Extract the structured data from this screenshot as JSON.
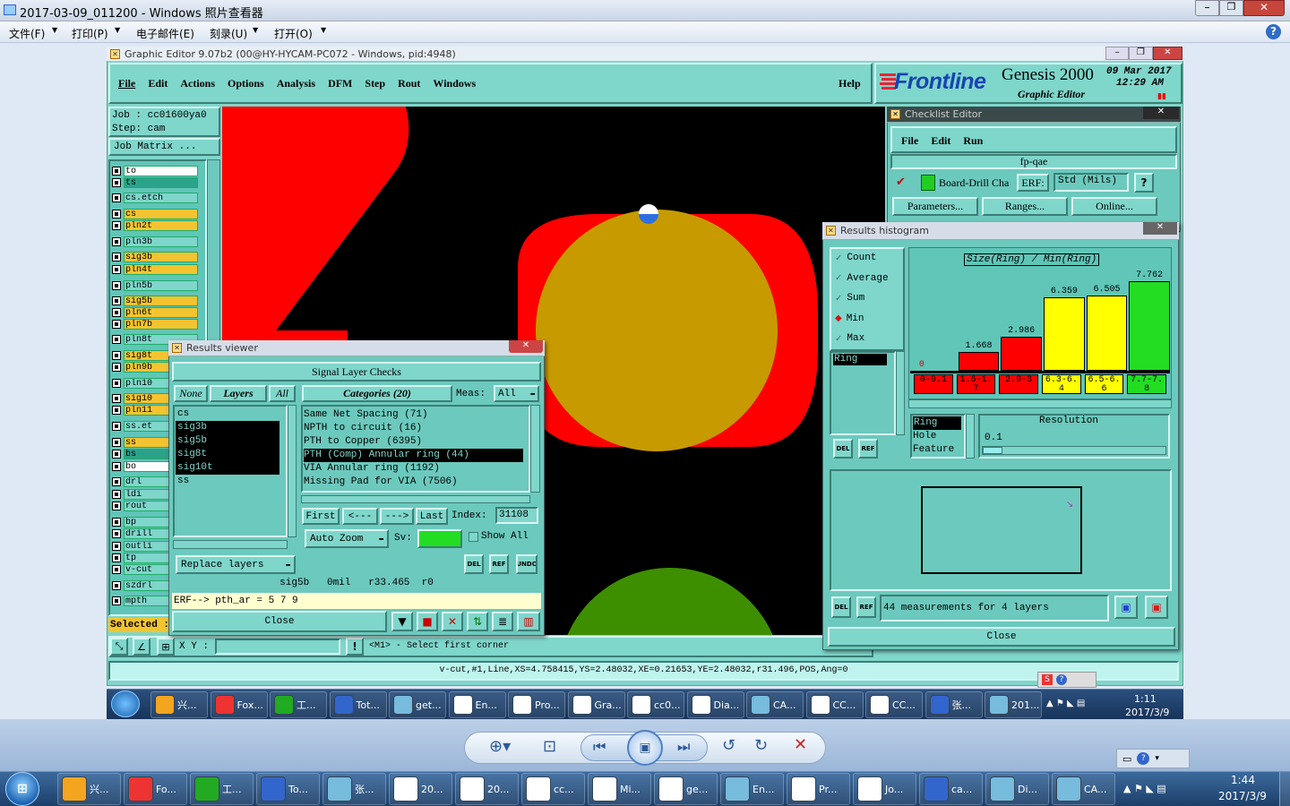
{
  "viewer": {
    "title": "2017-03-09_011200 - Windows 照片查看器",
    "menu": [
      "文件(F)",
      "打印(P)",
      "电子邮件(E)",
      "刻录(U)",
      "打开(O)"
    ]
  },
  "genesis": {
    "title": "Graphic Editor 9.07b2 (00@HY-HYCAM-PC072 - Windows, pid:4948)",
    "menu": [
      "File",
      "Edit",
      "Actions",
      "Options",
      "Analysis",
      "DFM",
      "Step",
      "Rout",
      "Windows"
    ],
    "help": "Help",
    "brand": "Frontline",
    "product": "Genesis 2000",
    "product_sub": "Graphic Editor",
    "date": "09 Mar 2017",
    "time": "12:29 AM",
    "job": "Job : cc01600ya0",
    "step": "Step: cam",
    "job_matrix": "Job Matrix ...",
    "selected": "Selected :",
    "xy_label": "X Y :",
    "prompt": "<M1> - Select first corner",
    "status": "v-cut,#1,Line,XS=4.758415,YS=2.48032,XE=0.21653,YE=2.48032,r31.496,POS,Ang=0"
  },
  "layers": [
    {
      "name": "to",
      "color": "#ffffff"
    },
    {
      "name": "ts",
      "color": "#2aa38a"
    },
    {
      "name": "cs.etch",
      "color": "#7fd6cb"
    },
    {
      "name": "cs",
      "color": "#f4c430"
    },
    {
      "name": "pln2t",
      "color": "#f4c430"
    },
    {
      "name": "pln3b",
      "color": "#7fd6cb"
    },
    {
      "name": "sig3b",
      "color": "#f4c430"
    },
    {
      "name": "pln4t",
      "color": "#f4c430"
    },
    {
      "name": "pln5b",
      "color": "#7fd6cb"
    },
    {
      "name": "sig5b",
      "color": "#f4c430"
    },
    {
      "name": "pln6t",
      "color": "#f4c430"
    },
    {
      "name": "pln7b",
      "color": "#f4c430"
    },
    {
      "name": "pln8t",
      "color": "#7fd6cb"
    },
    {
      "name": "sig8t",
      "color": "#f4c430"
    },
    {
      "name": "pln9b",
      "color": "#f4c430"
    },
    {
      "name": "pln10",
      "color": "#7fd6cb"
    },
    {
      "name": "sig10",
      "color": "#f4c430"
    },
    {
      "name": "pln11",
      "color": "#f4c430"
    },
    {
      "name": "ss.et",
      "color": "#7fd6cb"
    },
    {
      "name": "ss",
      "color": "#f4c430"
    },
    {
      "name": "bs",
      "color": "#2aa38a"
    },
    {
      "name": "bo",
      "color": "#ffffff"
    },
    {
      "name": "drl",
      "color": "#7fd6cb"
    },
    {
      "name": "ldi",
      "color": "#7fd6cb"
    },
    {
      "name": "rout",
      "color": "#7fd6cb"
    },
    {
      "name": "bp",
      "color": "#7fd6cb"
    },
    {
      "name": "drill",
      "color": "#7fd6cb"
    },
    {
      "name": "outli",
      "color": "#7fd6cb"
    },
    {
      "name": "tp",
      "color": "#7fd6cb"
    },
    {
      "name": "v-cut",
      "color": "#7fd6cb"
    },
    {
      "name": "szdrl",
      "color": "#7fd6cb"
    },
    {
      "name": "mpth",
      "color": "#7fd6cb"
    }
  ],
  "results_viewer": {
    "title": "Results viewer",
    "header": "Signal Layer Checks",
    "none": "None",
    "layers_label": "Layers",
    "all": "All",
    "categories_label": "Categories (20)",
    "meas_label": "Meas:",
    "meas_value": "All",
    "layer_list": [
      "cs",
      "sig3b",
      "sig5b",
      "sig8t",
      "sig10t",
      "ss"
    ],
    "categories": [
      "Same Net Spacing (71)",
      "NPTH to circuit (16)",
      "PTH to Copper (6395)",
      "PTH (Comp) Annular ring (44)",
      "VIA Annular ring (1192)",
      "Missing Pad for VIA (7506)"
    ],
    "first": "First",
    "prev": "<---",
    "next": "--->",
    "last": "Last",
    "index_label": "Index:",
    "index_value": "31108",
    "auto_zoom": "Auto Zoom",
    "sv_label": "Sv:",
    "show_all": "Show All",
    "replace_layers": "Replace layers",
    "info_line": "sig5b   0mil   r33.465  r0",
    "erf_line": "ERF--> pth_ar = 5 7 9",
    "close": "Close"
  },
  "checklist": {
    "title": "Checklist Editor",
    "menu": [
      "File",
      "Edit",
      "Run"
    ],
    "name": "fp-qae",
    "action": "Board-Drill Cha",
    "erf_label": "ERF:",
    "erf_value": "Std (Mils)",
    "buttons": [
      "Parameters...",
      "Ranges...",
      "Online..."
    ]
  },
  "histogram": {
    "title": "Results histogram",
    "options": [
      "Count",
      "Average",
      "Sum",
      "Min",
      "Max"
    ],
    "selected_option": "Min",
    "list_item": "Ring",
    "chart_title": "Size(Ring) / Min(Ring)",
    "bins": [
      {
        "range": "0-0.1",
        "value": 0,
        "color": "#ff0000",
        "label": "0"
      },
      {
        "range": "1.6-1.7",
        "value": 1.668,
        "color": "#ff0000",
        "label": "1.668"
      },
      {
        "range": "2.9-3",
        "value": 2.986,
        "color": "#ff0000",
        "label": "2.986"
      },
      {
        "range": "6.3-6.4",
        "value": 6.359,
        "color": "#ffff00",
        "label": "6.359"
      },
      {
        "range": "6.5-6.6",
        "value": 6.505,
        "color": "#ffff00",
        "label": "6.505"
      },
      {
        "range": "7.7-7.8",
        "value": 7.762,
        "color": "#22dd22",
        "label": "7.762"
      }
    ],
    "max_value": 7.762,
    "sub_list": [
      "Ring",
      "Hole",
      "Feature"
    ],
    "resolution_label": "Resolution",
    "resolution_value": "0.1",
    "measurements": "44 measurements for 4 layers",
    "close": "Close"
  },
  "taskbar_top": {
    "items": [
      "兴...",
      "Fox...",
      "工...",
      "Tot...",
      "get...",
      "En...",
      "Pro...",
      "Gra...",
      "cc0...",
      "Dia...",
      "CA...",
      "CC...",
      "CC...",
      "张...",
      "201..."
    ],
    "time": "1:11",
    "date": "2017/3/9"
  },
  "taskbar": {
    "items": [
      "兴...",
      "Fo...",
      "工...",
      "To...",
      "张...",
      "20...",
      "20...",
      "cc...",
      "Mi...",
      "ge...",
      "En...",
      "Pr...",
      "Jo...",
      "ca...",
      "Di...",
      "CA..."
    ],
    "time": "1:44",
    "date": "2017/3/9"
  }
}
